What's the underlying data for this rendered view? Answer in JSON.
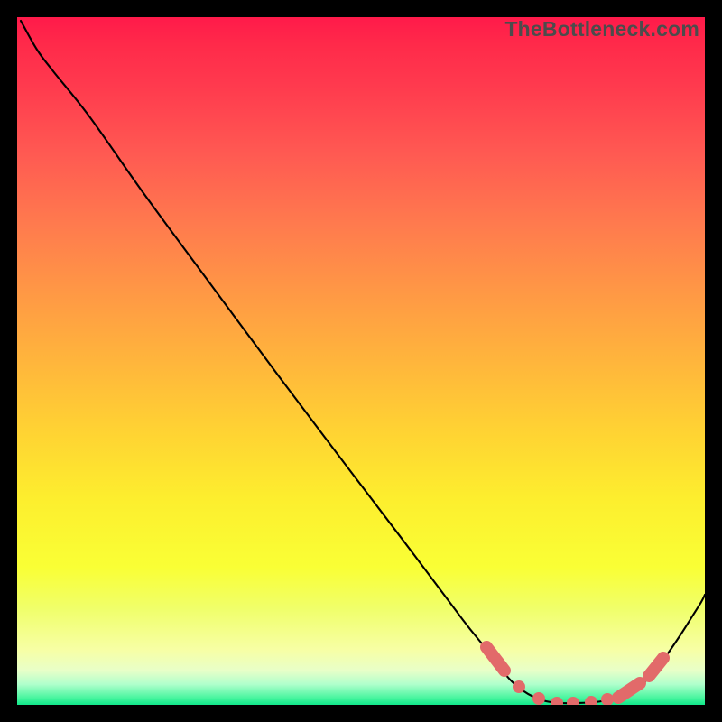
{
  "watermark": "TheBottleneck.com",
  "chart_data": {
    "type": "line",
    "title": "",
    "xlabel": "",
    "ylabel": "",
    "xlim": [
      0,
      762
    ],
    "ylim_inverted": [
      0,
      762
    ],
    "curve_points": [
      [
        4,
        4
      ],
      [
        22,
        36
      ],
      [
        40,
        60
      ],
      [
        80,
        110
      ],
      [
        140,
        195
      ],
      [
        210,
        290
      ],
      [
        290,
        398
      ],
      [
        370,
        504
      ],
      [
        440,
        596
      ],
      [
        494,
        668
      ],
      [
        518,
        698
      ],
      [
        536,
        722
      ],
      [
        548,
        736
      ],
      [
        560,
        746
      ],
      [
        572,
        753
      ],
      [
        586,
        758
      ],
      [
        602,
        760
      ],
      [
        620,
        760
      ],
      [
        640,
        759
      ],
      [
        658,
        756
      ],
      [
        674,
        750
      ],
      [
        688,
        742
      ],
      [
        700,
        732
      ],
      [
        716,
        712
      ],
      [
        734,
        686
      ],
      [
        748,
        664
      ],
      [
        758,
        648
      ],
      [
        762,
        640
      ]
    ],
    "marker_segments": [
      [
        [
          520,
          698
        ],
        [
          540,
          724
        ]
      ],
      [
        [
          666,
          754
        ],
        [
          690,
          738
        ]
      ],
      [
        [
          700,
          730
        ],
        [
          716,
          710
        ]
      ]
    ],
    "marker_dots": [
      [
        556,
        742
      ],
      [
        578,
        755
      ],
      [
        598,
        760
      ],
      [
        616,
        760
      ],
      [
        636,
        759
      ],
      [
        654,
        756
      ]
    ]
  }
}
